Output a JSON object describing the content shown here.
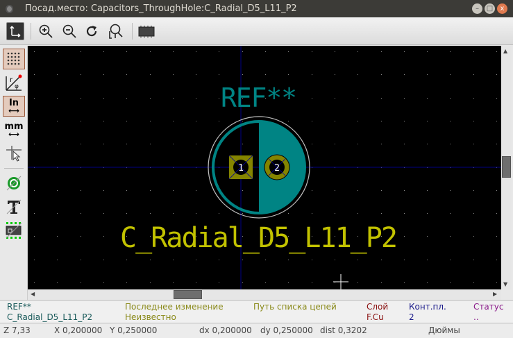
{
  "window": {
    "title": "Посад.место: Capacitors_ThroughHole:C_Radial_D5_L11_P2",
    "minimize": "–",
    "maximize": "□",
    "close": "x"
  },
  "canvas": {
    "reference": "REF**",
    "value": "C_Radial_D5_L11_P2",
    "pad1": "1",
    "pad2": "2",
    "colors": {
      "background": "#000000",
      "silk": "#008484",
      "fab": "#c2c200",
      "pad": "#848400",
      "courtyard": "#c2c2c2",
      "axis": "#000084"
    }
  },
  "msg_panel": {
    "ref": "REF**",
    "value": "C_Radial_D5_L11_P2",
    "last_change_label": "Последнее изменение",
    "last_change_value": "Неизвестно",
    "netlist_path_label": "Путь списка цепей",
    "layer_label": "Слой",
    "layer_value": "F.Cu",
    "pads_label": "Конт.пл.",
    "pads_value": "2",
    "status_label": "Статус",
    "status_value": ".."
  },
  "statusbar": {
    "zoom": "Z 7,33",
    "x": "X 0,200000",
    "y": "Y 0,250000",
    "dx": "dx 0,200000",
    "dy": "dy 0,250000",
    "dist": "dist 0,3202",
    "units": "Дюймы"
  },
  "left_toolbar": {
    "units_in": "In",
    "units_mm": "mm"
  }
}
